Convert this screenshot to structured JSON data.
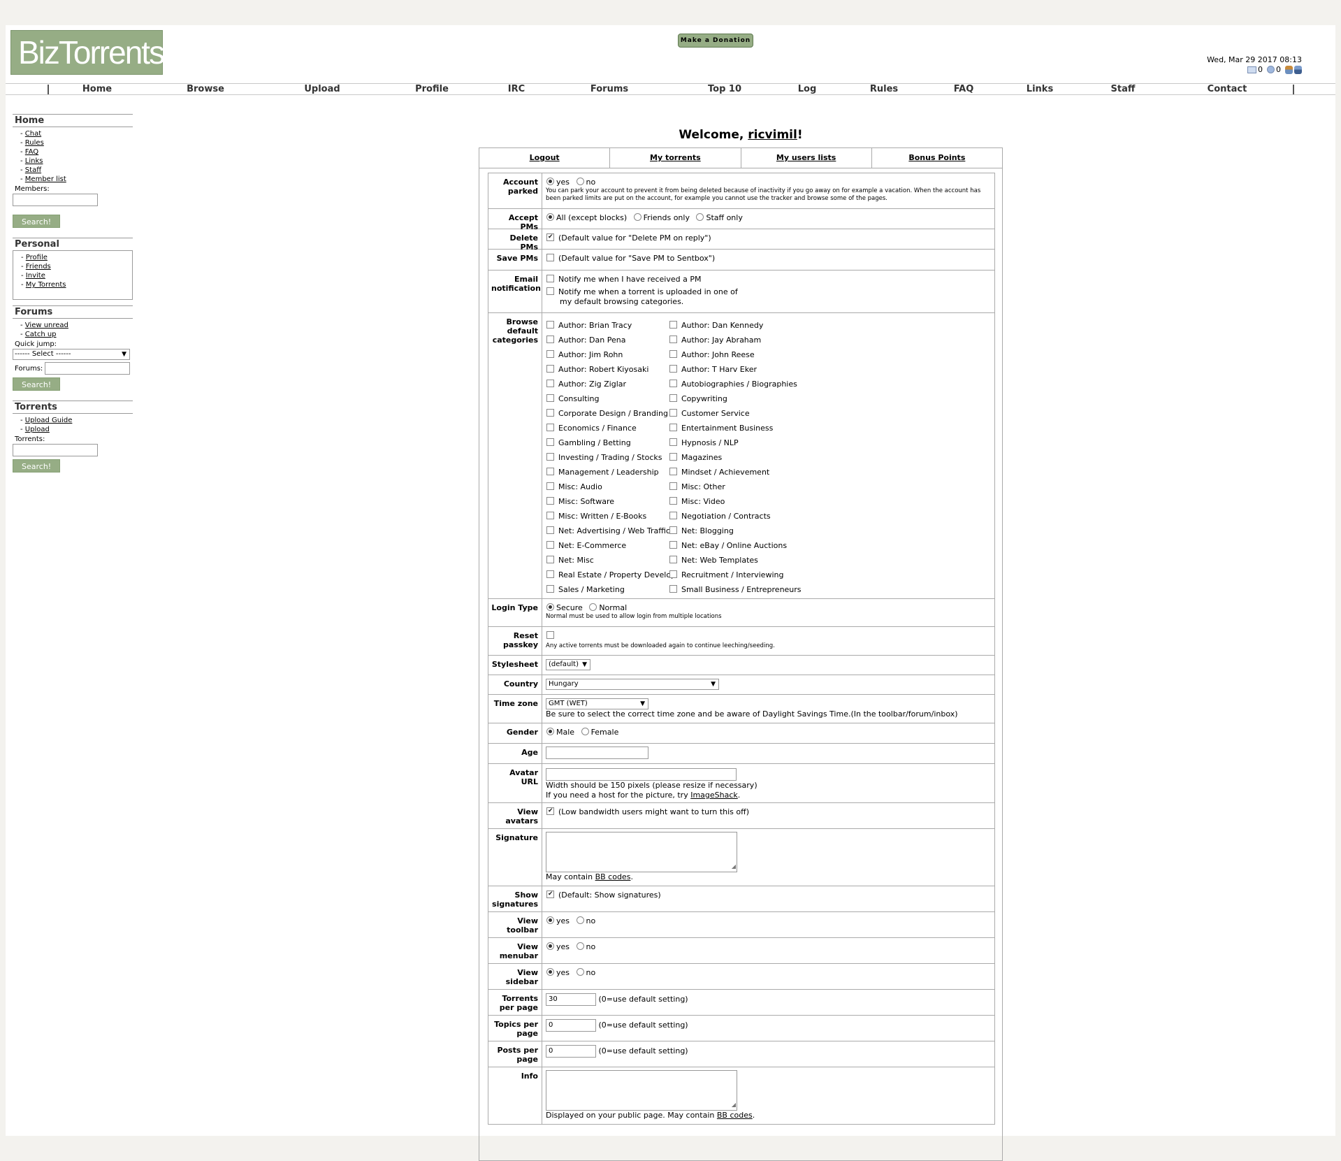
{
  "header": {
    "logo": "BizTorrents",
    "donate_label": "Make a Donation",
    "datetime": "Wed, Mar 29 2017 08:13",
    "inbox_count": "0",
    "sentbox_count": "0"
  },
  "nav": [
    "Home",
    "Browse",
    "Upload",
    "Profile",
    "IRC",
    "Forums",
    "Top 10",
    "Log",
    "Rules",
    "FAQ",
    "Links",
    "Staff",
    "Contact"
  ],
  "sidebar": {
    "home": {
      "title": "Home",
      "links": [
        "Chat",
        "Rules",
        "FAQ",
        "Links",
        "Staff",
        "Member list"
      ],
      "members_label": "Members:",
      "search_label": "Search!"
    },
    "personal": {
      "title": "Personal",
      "links": [
        "Profile",
        "Friends",
        "Invite",
        "My Torrents"
      ]
    },
    "forums": {
      "title": "Forums",
      "links": [
        "View unread",
        "Catch up"
      ],
      "quickjump_label": "Quick jump:",
      "quickjump_value": "------ Select ------",
      "forums_label": "Forums:",
      "search_label": "Search!"
    },
    "torrents": {
      "title": "Torrents",
      "links": [
        "Upload Guide",
        "Upload"
      ],
      "torrents_label": "Torrents:",
      "search_label": "Search!"
    }
  },
  "welcome": {
    "prefix": "Welcome, ",
    "username": "ricvimil",
    "suffix": "!"
  },
  "tabs": [
    "Logout",
    "My torrents",
    "My users lists",
    "Bonus Points"
  ],
  "form": {
    "account_parked": {
      "label": "Account parked",
      "yes": "yes",
      "no": "no",
      "note": "You can park your account to prevent it from being deleted because of inactivity if you go away on for example a vacation. When the account has been parked limits are put on the account, for example you cannot use the tracker and browse some of the pages."
    },
    "accept_pms": {
      "label": "Accept PMs",
      "opt1": "All (except blocks)",
      "opt2": "Friends only",
      "opt3": "Staff only"
    },
    "delete_pms": {
      "label": "Delete PMs",
      "text": "(Default value for \"Delete PM on reply\")"
    },
    "save_pms": {
      "label": "Save PMs",
      "text": "(Default value for \"Save PM to Sentbox\")"
    },
    "email_notification": {
      "label": "Email notification",
      "opt1": "Notify me when I have received a PM",
      "opt2a": "Notify me when a torrent is uploaded in one of",
      "opt2b": "my default browsing categories."
    },
    "browse_categories": {
      "label": "Browse default categories",
      "items": [
        "Author: Brian Tracy",
        "Author: Dan Kennedy",
        "Author: Dan Pena",
        "Author: Jay Abraham",
        "Author: Jim Rohn",
        "Author: John Reese",
        "Author: Robert Kiyosaki",
        "Author: T Harv Eker",
        "Author: Zig Ziglar",
        "Autobiographies / Biographies",
        "Consulting",
        "Copywriting",
        "Corporate Design / Branding",
        "Customer Service",
        "Economics / Finance",
        "Entertainment Business",
        "Gambling / Betting",
        "Hypnosis / NLP",
        "Investing / Trading / Stocks",
        "Magazines",
        "Management / Leadership",
        "Mindset / Achievement",
        "Misc: Audio",
        "Misc: Other",
        "Misc: Software",
        "Misc: Video",
        "Misc: Written / E-Books",
        "Negotiation / Contracts",
        "Net: Advertising / Web Traffic",
        "Net: Blogging",
        "Net: E-Commerce",
        "Net: eBay / Online Auctions",
        "Net: Misc",
        "Net: Web Templates",
        "Real Estate / Property Develop",
        "Recruitment / Interviewing",
        "Sales / Marketing",
        "Small Business / Entrepreneurs"
      ]
    },
    "login_type": {
      "label": "Login Type",
      "opt1": "Secure",
      "opt2": "Normal",
      "note": "Normal must be used to allow login from multiple locations"
    },
    "reset_passkey": {
      "label": "Reset passkey",
      "note": "Any active torrents must be downloaded again to continue leeching/seeding."
    },
    "stylesheet": {
      "label": "Stylesheet",
      "value": "(default)"
    },
    "country": {
      "label": "Country",
      "value": "Hungary"
    },
    "time_zone": {
      "label": "Time zone",
      "value": "GMT (WET)",
      "note": "Be sure to select the correct time zone and be aware of Daylight Savings Time.(In the toolbar/forum/inbox)"
    },
    "gender": {
      "label": "Gender",
      "opt1": "Male",
      "opt2": "Female"
    },
    "age": {
      "label": "Age",
      "value": ""
    },
    "avatar_url": {
      "label": "Avatar URL",
      "value": "",
      "note1": "Width should be 150 pixels (please resize if necessary)",
      "note2_prefix": "If you need a host for the picture, try ",
      "note2_link": "ImageShack",
      "note2_suffix": "."
    },
    "view_avatars": {
      "label": "View avatars",
      "text": "(Low bandwidth users might want to turn this off)"
    },
    "signature": {
      "label": "Signature",
      "note_prefix": "May contain ",
      "note_link": "BB codes",
      "note_suffix": "."
    },
    "show_signatures": {
      "label": "Show signatures",
      "text": "(Default: Show signatures)"
    },
    "view_toolbar": {
      "label": "View toolbar",
      "yes": "yes",
      "no": "no"
    },
    "view_menubar": {
      "label": "View menubar",
      "yes": "yes",
      "no": "no"
    },
    "view_sidebar": {
      "label": "View sidebar",
      "yes": "yes",
      "no": "no"
    },
    "torrents_per_page": {
      "label": "Torrents per page",
      "value": "30",
      "hint": "(0=use default setting)"
    },
    "topics_per_page": {
      "label": "Topics per page",
      "value": "0",
      "hint": "(0=use default setting)"
    },
    "posts_per_page": {
      "label": "Posts per page",
      "value": "0",
      "hint": "(0=use default setting)"
    },
    "info": {
      "label": "Info",
      "note_prefix": "Displayed on your public page. May contain ",
      "note_link": "BB codes",
      "note_suffix": "."
    }
  }
}
